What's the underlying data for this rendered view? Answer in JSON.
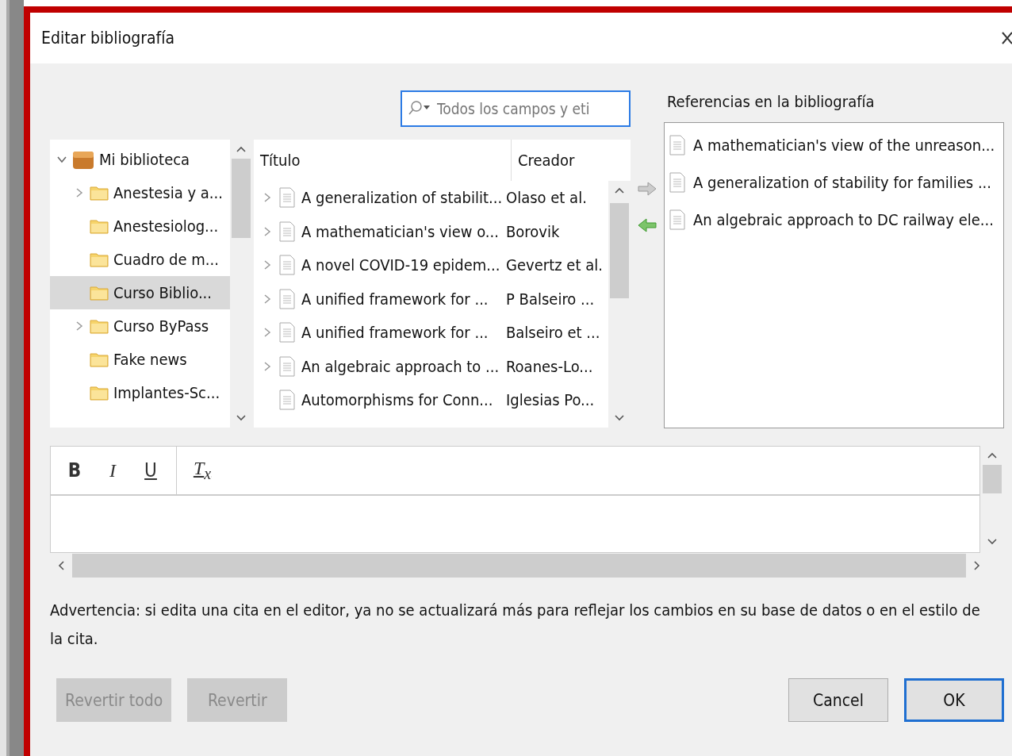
{
  "window": {
    "title": "Editar bibliografía"
  },
  "search": {
    "placeholder": "Todos los campos y eti"
  },
  "library_tree": {
    "items": [
      {
        "label": "Mi biblioteca",
        "kind": "library",
        "expanded": true,
        "selected": false,
        "children": [
          {
            "label": "Anestesia y a...",
            "kind": "folder",
            "expandable": true,
            "selected": false
          },
          {
            "label": "Anestesiolog...",
            "kind": "folder",
            "expandable": false,
            "selected": false
          },
          {
            "label": "Cuadro de m...",
            "kind": "folder",
            "expandable": false,
            "selected": false
          },
          {
            "label": "Curso Biblio...",
            "kind": "folder",
            "expandable": false,
            "selected": true
          },
          {
            "label": "Curso ByPass",
            "kind": "folder",
            "expandable": true,
            "selected": false
          },
          {
            "label": "Fake news",
            "kind": "folder",
            "expandable": false,
            "selected": false
          },
          {
            "label": "Implantes-Sc...",
            "kind": "folder",
            "expandable": false,
            "selected": false
          }
        ]
      }
    ]
  },
  "items_table": {
    "columns": [
      "Título",
      "Creador"
    ],
    "rows": [
      {
        "title": "A generalization of stabilit...",
        "creator": "Olaso et al.",
        "expandable": true
      },
      {
        "title": "A mathematician's view o...",
        "creator": "Borovik",
        "expandable": true
      },
      {
        "title": "A novel COVID-19 epidem...",
        "creator": "Gevertz et al.",
        "expandable": true
      },
      {
        "title": "A unified framework for ...",
        "creator": "P Balseiro ...",
        "expandable": true
      },
      {
        "title": "A unified framework for ...",
        "creator": "Balseiro et ...",
        "expandable": true
      },
      {
        "title": "An algebraic approach to ...",
        "creator": "Roanes-Lo...",
        "expandable": true
      },
      {
        "title": "Automorphisms for Conn...",
        "creator": "Iglesias Po...",
        "expandable": false
      }
    ]
  },
  "references": {
    "label": "Referencias en la bibliografía",
    "items": [
      "A mathematician's view of the unreason...",
      "A generalization of stability for families ...",
      "An algebraic approach to DC railway ele..."
    ]
  },
  "editor_toolbar": [
    {
      "kind": "bold",
      "label": "B"
    },
    {
      "kind": "italic",
      "label": "I"
    },
    {
      "kind": "underline",
      "label": "U"
    },
    {
      "kind": "clear",
      "label": "T$_{x}$"
    }
  ],
  "warning": "Advertencia: si edita una cita en el editor, ya no se actualizará más para reflejar los cambios en su base de datos o en el estilo de la cita.",
  "buttons": [
    {
      "label": "Revertir todo",
      "disabled": true,
      "default": false
    },
    {
      "label": "Revertir",
      "disabled": true,
      "default": false
    },
    {
      "label": "Cancel",
      "disabled": false,
      "default": false
    },
    {
      "label": "OK",
      "disabled": false,
      "default": true
    }
  ]
}
